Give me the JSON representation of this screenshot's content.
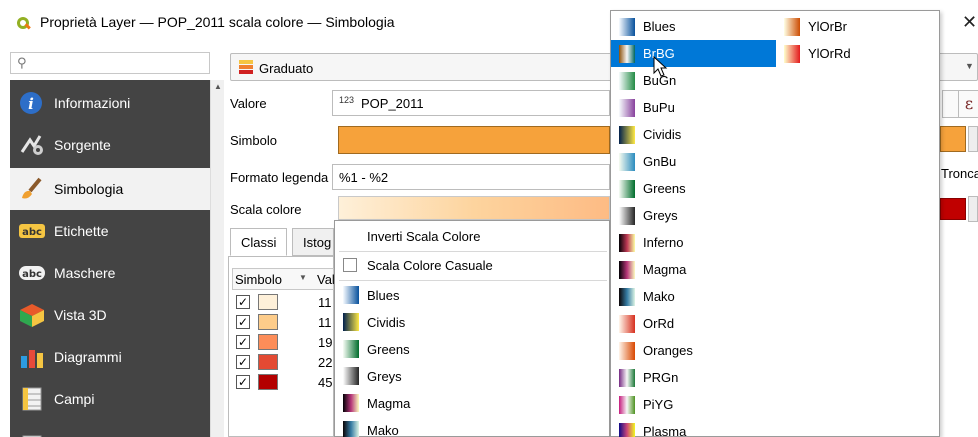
{
  "window": {
    "title": "Proprietà Layer — POP_2011 scala colore — Simbologia",
    "close": "✕"
  },
  "search": {
    "placeholder": ""
  },
  "sidebar": {
    "items": [
      {
        "label": "Informazioni",
        "icon": "info-icon"
      },
      {
        "label": "Sorgente",
        "icon": "source-icon"
      },
      {
        "label": "Simbologia",
        "icon": "paintbrush-icon",
        "active": true
      },
      {
        "label": "Etichette",
        "icon": "labels-icon"
      },
      {
        "label": "Maschere",
        "icon": "masks-icon"
      },
      {
        "label": "Vista 3D",
        "icon": "3d-view-icon"
      },
      {
        "label": "Diagrammi",
        "icon": "diagrams-icon"
      },
      {
        "label": "Campi",
        "icon": "fields-icon"
      }
    ]
  },
  "renderer": {
    "label": "Graduato"
  },
  "form": {
    "value_label": "Valore",
    "value_prefix": "123",
    "value": "POP_2011",
    "symbol_label": "Simbolo",
    "legend_label": "Formato legenda",
    "legend_value": "%1 - %2",
    "ramp_label": "Scala colore",
    "truncate_label": "Tronca",
    "expression_symbol": "ε"
  },
  "tabs": [
    {
      "label": "Classi"
    },
    {
      "label": "Istog"
    }
  ],
  "classes": {
    "headers": {
      "symbol": "Simbolo",
      "value": "Val"
    },
    "rows": [
      {
        "checked": true,
        "color": "#fef0d9",
        "value": "11"
      },
      {
        "checked": true,
        "color": "#fdcc8a",
        "value": "11"
      },
      {
        "checked": true,
        "color": "#fc8d59",
        "value": "19"
      },
      {
        "checked": true,
        "color": "#e34a33",
        "value": "22"
      },
      {
        "checked": true,
        "color": "#b30000",
        "value": "45"
      }
    ]
  },
  "ramp_menu": {
    "invert": "Inverti Scala Colore",
    "random": "Scala Colore Casuale",
    "ramps": [
      {
        "label": "Blues",
        "colors": [
          "#f7fbff",
          "#08519c"
        ]
      },
      {
        "label": "Cividis",
        "colors": [
          "#00204c",
          "#ffe945"
        ]
      },
      {
        "label": "Greens",
        "colors": [
          "#f7fcf5",
          "#006d2c"
        ]
      },
      {
        "label": "Greys",
        "colors": [
          "#ffffff",
          "#252525"
        ]
      },
      {
        "label": "Magma",
        "colors": [
          "#000004",
          "#b63679",
          "#fcfdbf"
        ]
      },
      {
        "label": "Mako",
        "colors": [
          "#0b0405",
          "#357ba3",
          "#def5e5"
        ]
      }
    ]
  },
  "ramp_submenu": {
    "col1": [
      {
        "label": "Blues",
        "colors": [
          "#f7fbff",
          "#08519c"
        ]
      },
      {
        "label": "BrBG",
        "colors": [
          "#8c510a",
          "#f5f5f5",
          "#01665e"
        ],
        "hover": true
      },
      {
        "label": "BuGn",
        "colors": [
          "#f7fcfd",
          "#238b45"
        ]
      },
      {
        "label": "BuPu",
        "colors": [
          "#f7fcfd",
          "#88419d"
        ]
      },
      {
        "label": "Cividis",
        "colors": [
          "#00204c",
          "#ffe945"
        ]
      },
      {
        "label": "GnBu",
        "colors": [
          "#f7fcf0",
          "#2b8cbe"
        ]
      },
      {
        "label": "Greens",
        "colors": [
          "#f7fcf5",
          "#006d2c"
        ]
      },
      {
        "label": "Greys",
        "colors": [
          "#ffffff",
          "#252525"
        ]
      },
      {
        "label": "Inferno",
        "colors": [
          "#000004",
          "#bc3754",
          "#fcffa4"
        ]
      },
      {
        "label": "Magma",
        "colors": [
          "#000004",
          "#b63679",
          "#fcfdbf"
        ]
      },
      {
        "label": "Mako",
        "colors": [
          "#0b0405",
          "#357ba3",
          "#def5e5"
        ]
      },
      {
        "label": "OrRd",
        "colors": [
          "#fff7ec",
          "#d7301f"
        ]
      },
      {
        "label": "Oranges",
        "colors": [
          "#fff5eb",
          "#d94801"
        ]
      },
      {
        "label": "PRGn",
        "colors": [
          "#762a83",
          "#f7f7f7",
          "#1b7837"
        ]
      },
      {
        "label": "PiYG",
        "colors": [
          "#c51b7d",
          "#f7f7f7",
          "#4d9221"
        ]
      },
      {
        "label": "Plasma",
        "colors": [
          "#0d0887",
          "#cc4778",
          "#f0f921"
        ]
      }
    ],
    "col2": [
      {
        "label": "YlOrBr",
        "colors": [
          "#ffffe5",
          "#cc4c02"
        ]
      },
      {
        "label": "YlOrRd",
        "colors": [
          "#ffffcc",
          "#e31a1c"
        ]
      }
    ]
  }
}
